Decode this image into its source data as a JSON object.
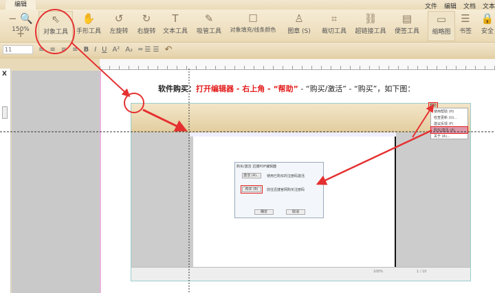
{
  "tabbar": {
    "active_tab": "编辑",
    "menu": [
      "文件",
      "编辑",
      "文档",
      "文本"
    ]
  },
  "toolbar": {
    "zoom": "150%",
    "tools": [
      {
        "label": "对象工具",
        "icon": "cursor-icon"
      },
      {
        "label": "手形工具",
        "icon": "hand-icon"
      },
      {
        "label": "左旋转",
        "icon": "rotate-left-icon"
      },
      {
        "label": "右旋转",
        "icon": "rotate-right-icon"
      },
      {
        "label": "文本工具",
        "icon": "text-icon"
      },
      {
        "label": "吸管工具",
        "icon": "eyedropper-icon"
      },
      {
        "label": "对象填充/线条颜色",
        "icon": "fill-color-icon"
      },
      {
        "label": "图章 (S)",
        "icon": "stamp-icon"
      },
      {
        "label": "裁切工具",
        "icon": "crop-icon"
      },
      {
        "label": "超链接工具",
        "icon": "link-icon"
      },
      {
        "label": "便签工具",
        "icon": "note-icon"
      },
      {
        "label": "缩略图",
        "icon": "thumbnail-icon"
      },
      {
        "label": "书签",
        "icon": "bookmark-icon"
      },
      {
        "label": "安全",
        "icon": "lock-icon"
      }
    ]
  },
  "format": {
    "font_size": "11",
    "bold": "B",
    "italic": "I",
    "underline": "U",
    "superscript": "A²",
    "subscript": "A₂"
  },
  "left_panel": {
    "close": "X"
  },
  "content": {
    "headline_lead": "软件购买：",
    "headline_red": "打开编辑器 - 右上角 - “帮助”",
    "headline_rest": " - “购买/激活” - “购买”，如下图："
  },
  "embedded": {
    "dialog_title": "购买/激活 迅捷PDF编辑器",
    "activate_btn": "激活 (A)...",
    "activate_text": "使用已购买的注册码激活",
    "buy_btn": "购买 (B)",
    "buy_text": "前往迅捷官网购买注册码",
    "ok_btn": "确定",
    "cancel_btn": "取消",
    "help_menu": [
      "帮助",
      "使用帮助 (H)",
      "检查更新 (U)...",
      "建议反馈 (F)",
      "购买/激活 (A)",
      "关于 (A)..."
    ],
    "status_zoom": "100%",
    "status_page": "1 / 10"
  },
  "colors": {
    "accent": "#e31b1b",
    "toolbar": "#ead9b4"
  }
}
